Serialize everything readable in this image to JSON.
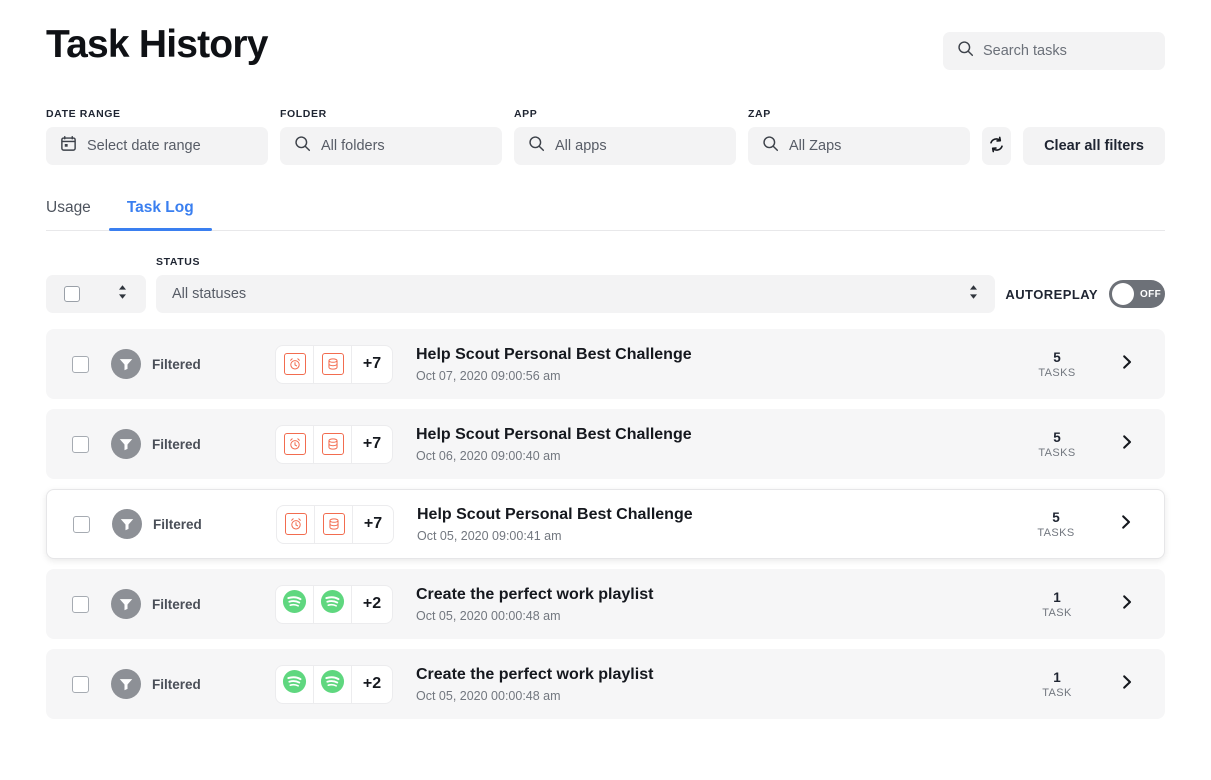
{
  "header": {
    "title": "Task History",
    "search": {
      "placeholder": "Search tasks",
      "value": "",
      "icon": "search-icon"
    }
  },
  "filters": {
    "date_range": {
      "label": "DATE RANGE",
      "placeholder": "Select date range",
      "icon": "calendar-icon"
    },
    "folder": {
      "label": "FOLDER",
      "placeholder": "All folders",
      "icon": "search-icon"
    },
    "app": {
      "label": "APP",
      "placeholder": "All apps",
      "icon": "search-icon"
    },
    "zap": {
      "label": "ZAP",
      "placeholder": "All Zaps",
      "icon": "search-icon"
    },
    "refresh": {
      "icon": "refresh-icon"
    },
    "clear_all": "Clear all filters"
  },
  "tabs": [
    {
      "label": "Usage",
      "active": false
    },
    {
      "label": "Task Log",
      "active": true
    }
  ],
  "list_controls": {
    "select_all": {
      "checked": false,
      "icon": "sort-updown-icon"
    },
    "status": {
      "label": "STATUS",
      "value": "All statuses",
      "icon": "sort-updown-icon"
    },
    "autoreplay": {
      "label": "AUTOREPLAY",
      "state": "OFF",
      "on": false
    }
  },
  "rows": [
    {
      "checked": false,
      "status": "Filtered",
      "status_icon": "funnel-icon",
      "apps": [
        "alarm-clock-icon",
        "database-icon"
      ],
      "app_overflow": "+7",
      "title": "Help Scout Personal Best Challenge",
      "timestamp": "Oct 07, 2020 09:00:56 am",
      "task_count": "5",
      "task_count_label": "TASKS",
      "highlight": false
    },
    {
      "checked": false,
      "status": "Filtered",
      "status_icon": "funnel-icon",
      "apps": [
        "alarm-clock-icon",
        "database-icon"
      ],
      "app_overflow": "+7",
      "title": "Help Scout Personal Best Challenge",
      "timestamp": "Oct 06, 2020 09:00:40 am",
      "task_count": "5",
      "task_count_label": "TASKS",
      "highlight": false
    },
    {
      "checked": false,
      "status": "Filtered",
      "status_icon": "funnel-icon",
      "apps": [
        "alarm-clock-icon",
        "database-icon"
      ],
      "app_overflow": "+7",
      "title": "Help Scout Personal Best Challenge",
      "timestamp": "Oct 05, 2020 09:00:41 am",
      "task_count": "5",
      "task_count_label": "TASKS",
      "highlight": true
    },
    {
      "checked": false,
      "status": "Filtered",
      "status_icon": "funnel-icon",
      "apps": [
        "spotify-icon",
        "spotify-icon"
      ],
      "app_overflow": "+2",
      "title": "Create the perfect work playlist",
      "timestamp": "Oct 05, 2020 00:00:48 am",
      "task_count": "1",
      "task_count_label": "TASK",
      "highlight": false
    },
    {
      "checked": false,
      "status": "Filtered",
      "status_icon": "funnel-icon",
      "apps": [
        "spotify-icon",
        "spotify-icon"
      ],
      "app_overflow": "+2",
      "title": "Create the perfect work playlist",
      "timestamp": "Oct 05, 2020 00:00:48 am",
      "task_count": "1",
      "task_count_label": "TASK",
      "highlight": false
    }
  ],
  "colors": {
    "accent_blue": "#3a7ff0",
    "app_orange": "#f26c4f",
    "spotify_green": "#5fd77f",
    "field_bg": "#f3f3f4",
    "row_bg": "#f6f6f7"
  }
}
